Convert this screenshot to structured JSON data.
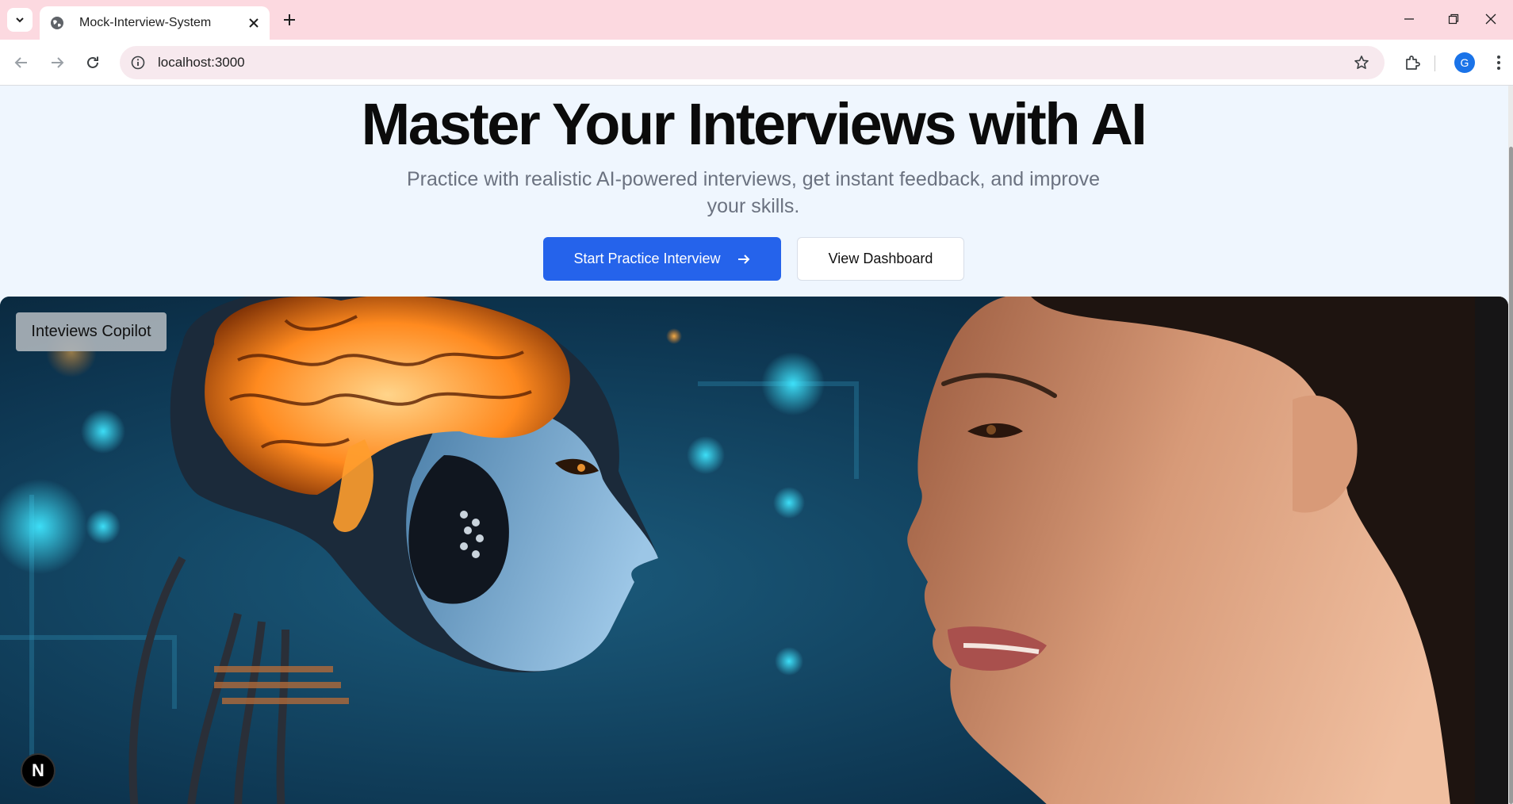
{
  "browser": {
    "tab_title": "Mock-Interview-System",
    "url": "localhost:3000",
    "profile_initial": "G",
    "icons": {
      "tab_list": "chevron-down-icon",
      "favicon": "globe-icon",
      "close_tab": "close-icon",
      "new_tab": "plus-icon",
      "back": "arrow-left-icon",
      "forward": "arrow-right-icon",
      "reload": "reload-icon",
      "site_info": "info-icon",
      "bookmark": "star-icon",
      "extensions": "puzzle-icon",
      "menu": "kebab-menu-icon",
      "minimize": "minimize-icon",
      "restore": "restore-icon",
      "close_window": "close-icon"
    }
  },
  "hero": {
    "title": "Master Your Interviews with AI",
    "subtitle_line1": "Practice with realistic AI-powered interviews, get instant feedback, and improve",
    "subtitle_line2": "your skills.",
    "primary_button": "Start Practice Interview",
    "secondary_button": "View Dashboard",
    "image_badge": "Inteviews Copilot",
    "dev_badge": "N"
  },
  "colors": {
    "primary": "#2563eb",
    "page_background": "#eff6fe",
    "tab_strip": "#fcd9e0"
  }
}
